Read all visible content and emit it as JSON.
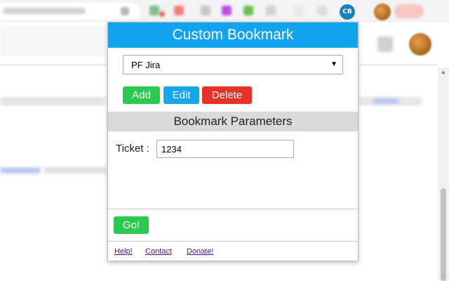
{
  "browser": {
    "extension_badge": "CB"
  },
  "popup": {
    "title": "Custom Bookmark",
    "bookmark_select": {
      "selected": "PF Jira"
    },
    "buttons": {
      "add": "Add",
      "edit": "Edit",
      "delete": "Delete",
      "go": "Go!"
    },
    "parameters": {
      "heading": "Bookmark Parameters",
      "ticket_label": "Ticket :",
      "ticket_value": "1234"
    },
    "footer": {
      "help": "Help!",
      "contact": "Contact",
      "donate": "Donate!"
    }
  },
  "colors": {
    "header": "#10a4ef",
    "add_go": "#2ac94f",
    "edit": "#15a6ee",
    "delete": "#e5332a",
    "params_header": "#d9d9d9",
    "link": "#4b1a78"
  },
  "icons": {
    "dropdown": "chevron-down-icon",
    "extension": "custom-bookmark-extension-icon"
  }
}
